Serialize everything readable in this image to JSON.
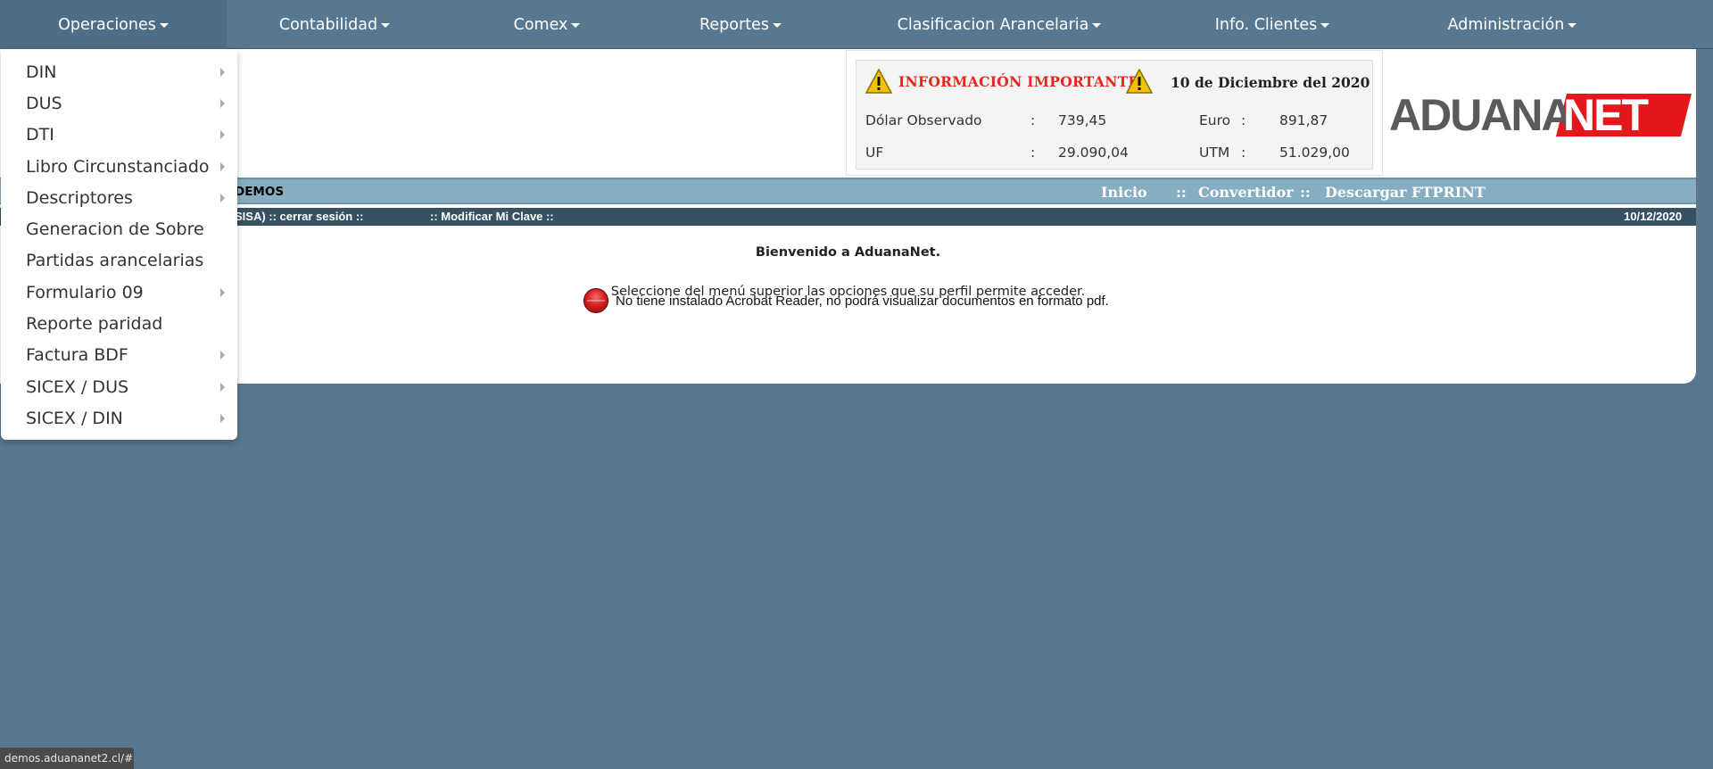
{
  "nav": {
    "items": [
      {
        "label": "Operaciones"
      },
      {
        "label": "Contabilidad"
      },
      {
        "label": "Comex"
      },
      {
        "label": "Reportes"
      },
      {
        "label": "Clasificacion Arancelaria"
      },
      {
        "label": "Info. Clientes"
      },
      {
        "label": "Administración"
      }
    ]
  },
  "dropdown": {
    "items": [
      {
        "label": "DIN",
        "submenu": true
      },
      {
        "label": "DUS",
        "submenu": true
      },
      {
        "label": "DTI",
        "submenu": true
      },
      {
        "label": "Libro Circunstanciado",
        "submenu": true
      },
      {
        "label": "Descriptores",
        "submenu": true
      },
      {
        "label": "Generacion de Sobre",
        "submenu": false
      },
      {
        "label": "Partidas arancelarias",
        "submenu": false
      },
      {
        "label": "Formulario 09",
        "submenu": true
      },
      {
        "label": "Reporte paridad",
        "submenu": false
      },
      {
        "label": "Factura BDF",
        "submenu": true
      },
      {
        "label": "SICEX / DUS",
        "submenu": true
      },
      {
        "label": "SICEX / DIN",
        "submenu": true
      }
    ]
  },
  "info": {
    "title": "INFORMACIÓN IMPORTANTE",
    "date": "10 de Diciembre del 2020",
    "rates": {
      "dolar_label": "Dólar Observado",
      "dolar_value": "739,45",
      "euro_label": "Euro",
      "euro_value": "891,87",
      "uf_label": "UF",
      "uf_value": "29.090,04",
      "utm_label": "UTM",
      "utm_value": "51.029,00",
      "colon": ":"
    }
  },
  "logo": {
    "part1": "ADUANA",
    "part2": "NET"
  },
  "header_bar": {
    "company": "DEMOS",
    "links": [
      "Inicio",
      "Convertidor",
      "Descargar FTPRINT"
    ],
    "separator": "::"
  },
  "user_bar": {
    "session": "SISA) :: cerrar sesión ::",
    "change_password": ":: Modificar Mi Clave ::",
    "date": "10/12/2020"
  },
  "main": {
    "welcome": "Bienvenido a AduanaNet.",
    "instruction": "Seleccione del menú superior las opciones que su perfil permite acceder.",
    "pdf_warning": "No tiene instalado Acrobat Reader, no podrá visualizar documentos en formato pdf."
  },
  "status_url": "demos.aduananet2.cl/#",
  "colors": {
    "nav_bg": "#587891",
    "accent_red": "#e3181c",
    "bar_light": "#87adc0",
    "bar_dark": "#375062"
  }
}
